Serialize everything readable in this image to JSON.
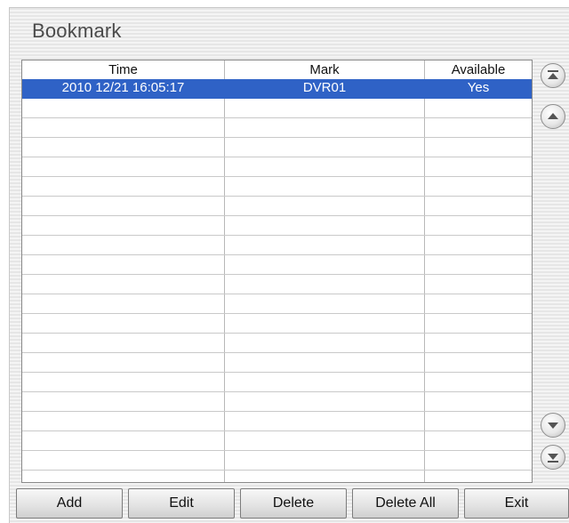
{
  "dialog": {
    "title": "Bookmark"
  },
  "table": {
    "headers": {
      "time": "Time",
      "mark": "Mark",
      "available": "Available"
    },
    "rows": [
      {
        "time": "2010 12/21 16:05:17",
        "mark": "DVR01",
        "available": "Yes",
        "selected": true
      }
    ]
  },
  "scroll_icons": [
    "first-page-icon",
    "page-up-icon",
    "page-down-icon",
    "last-page-icon"
  ],
  "buttons": {
    "add": "Add",
    "edit": "Edit",
    "delete": "Delete",
    "delete_all": "Delete All",
    "exit": "Exit"
  },
  "colors": {
    "selection": "#2f62c6"
  }
}
